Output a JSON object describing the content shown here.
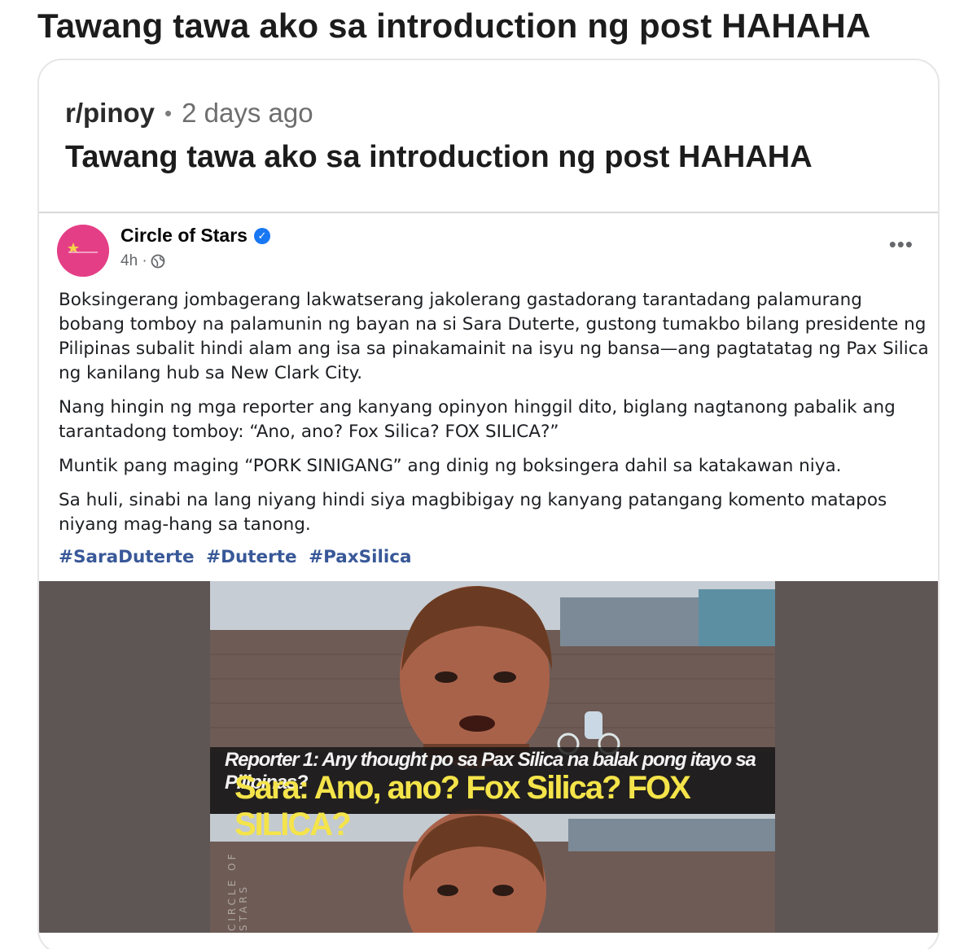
{
  "page": {
    "title": "Tawang tawa ako sa introduction ng post HAHAHA"
  },
  "post": {
    "subreddit": "r/pinoy",
    "separator": "•",
    "time_ago": "2 days ago",
    "title": "Tawang tawa ako sa introduction ng post HAHAHA"
  },
  "facebook_post": {
    "page_name": "Circle of Stars",
    "verified": true,
    "time": "4h ·",
    "more_label": "•••",
    "paragraphs": [
      "Boksingerang jombagerang lakwatserang jakolerang gastadorang tarantadang palamurang bobang tomboy na palamunin ng bayan na si Sara Duterte, gustong tumakbo bilang presidente ng Pilipinas subalit hindi alam ang isa sa pinakamainit na isyu ng bansa—ang pagtatatag ng Pax Silica ng kanilang hub sa New Clark City.",
      "Nang hingin ng mga reporter ang kanyang opinyon hinggil dito, biglang nagtanong pabalik ang tarantadong tomboy: “Ano, ano? Fox Silica? FOX SILICA?”",
      "Muntik pang maging “PORK SINIGANG” ang dinig ng boksingera dahil sa katakawan niya.",
      "Sa huli, sinabi na lang niyang hindi siya magbibigay ng kanyang patangang komento matapos niyang mag-hang sa tanong."
    ],
    "hashtags": [
      "#SaraDuterte",
      "#Duterte",
      "#PaxSilica"
    ],
    "image": {
      "reporter_caption": "Reporter 1: Any thought po sa Pax Silica na balak pong itayo sa Pilipinas?",
      "sara_caption": "Sara: Ano, ano? Fox Silica? FOX SILICA?",
      "watermark": "CIRCLE OF STARS"
    }
  },
  "colors": {
    "avatar": "#e43f86",
    "hashtag": "#385898",
    "verified": "#1877f2",
    "caption_yellow": "#f4e44a"
  }
}
